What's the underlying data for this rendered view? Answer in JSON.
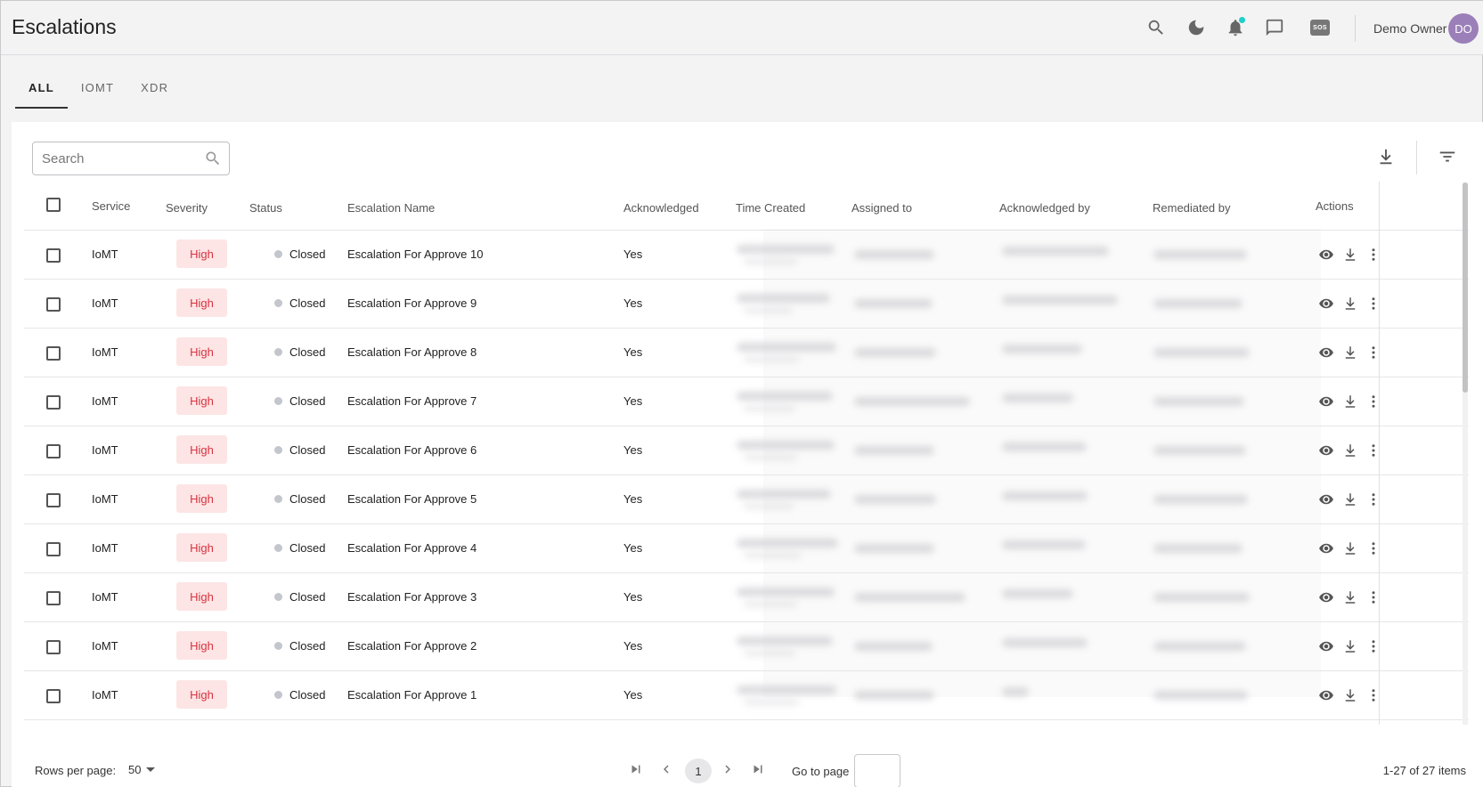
{
  "header": {
    "title": "Escalations",
    "user_name": "Demo Owner",
    "avatar_initials": "DO",
    "icons": [
      "search-icon",
      "moon-icon",
      "bell-icon",
      "chat-icon",
      "sos-icon"
    ],
    "sos_label": "SOS",
    "notification_dot_color": "#1fcfc9"
  },
  "tabs": [
    {
      "label": "ALL",
      "active": true
    },
    {
      "label": "IOMT",
      "active": false
    },
    {
      "label": "XDR",
      "active": false
    }
  ],
  "toolbar": {
    "search_placeholder": "Search",
    "download_icon": "download-icon",
    "filter_icon": "filter-icon"
  },
  "table": {
    "columns": {
      "service": "Service",
      "severity": "Severity",
      "status": "Status",
      "escalation_name": "Escalation Name",
      "acknowledged": "Acknowledged",
      "time_created": "Time Created",
      "assigned_to": "Assigned to",
      "acknowledged_by": "Acknowledged by",
      "remediated_by": "Remediated by",
      "actions": "Actions"
    },
    "rows": [
      {
        "service": "IoMT",
        "severity": "High",
        "status": "Closed",
        "name": "Escalation For Approve 10",
        "acknowledged": "Yes"
      },
      {
        "service": "IoMT",
        "severity": "High",
        "status": "Closed",
        "name": "Escalation For Approve 9",
        "acknowledged": "Yes"
      },
      {
        "service": "IoMT",
        "severity": "High",
        "status": "Closed",
        "name": "Escalation For Approve 8",
        "acknowledged": "Yes"
      },
      {
        "service": "IoMT",
        "severity": "High",
        "status": "Closed",
        "name": "Escalation For Approve 7",
        "acknowledged": "Yes"
      },
      {
        "service": "IoMT",
        "severity": "High",
        "status": "Closed",
        "name": "Escalation For Approve 6",
        "acknowledged": "Yes"
      },
      {
        "service": "IoMT",
        "severity": "High",
        "status": "Closed",
        "name": "Escalation For Approve 5",
        "acknowledged": "Yes"
      },
      {
        "service": "IoMT",
        "severity": "High",
        "status": "Closed",
        "name": "Escalation For Approve 4",
        "acknowledged": "Yes"
      },
      {
        "service": "IoMT",
        "severity": "High",
        "status": "Closed",
        "name": "Escalation For Approve 3",
        "acknowledged": "Yes"
      },
      {
        "service": "IoMT",
        "severity": "High",
        "status": "Closed",
        "name": "Escalation For Approve 2",
        "acknowledged": "Yes"
      },
      {
        "service": "IoMT",
        "severity": "High",
        "status": "Closed",
        "name": "Escalation For Approve 1",
        "acknowledged": "Yes"
      }
    ],
    "row_actions": [
      "eye-icon",
      "download-icon",
      "more-vertical-icon"
    ],
    "colors": {
      "severity_high_bg": "#fde5e5",
      "severity_high_text": "#d8323f",
      "status_closed_dot": "#c3c6cc"
    }
  },
  "footer": {
    "rows_per_page_label": "Rows per page:",
    "rows_per_page_value": "50",
    "current_page": "1",
    "go_to_page_label": "Go to page",
    "items_count": "1-27 of 27 items"
  }
}
